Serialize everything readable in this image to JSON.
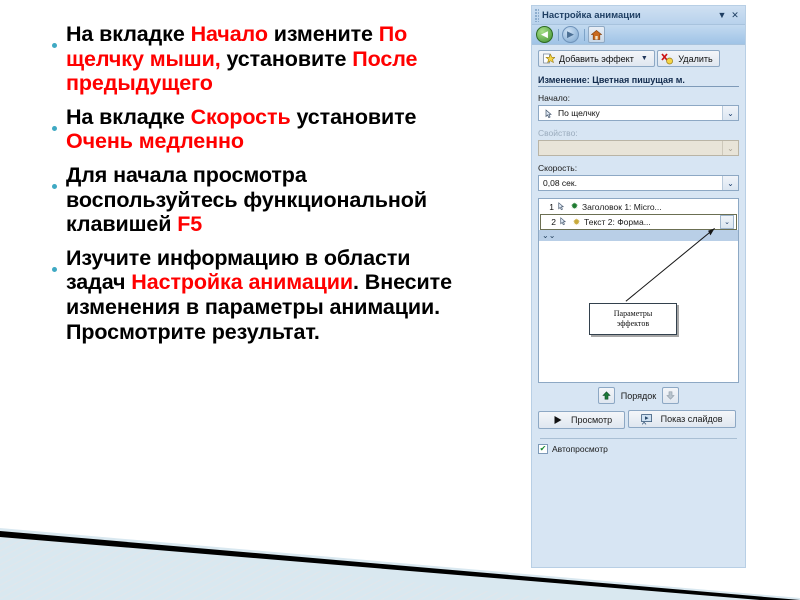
{
  "slide": {
    "bullets": [
      {
        "id": "bullet-1",
        "segments": [
          {
            "text": "На вкладке ",
            "highlight": false
          },
          {
            "text": "Начало",
            "highlight": true
          },
          {
            "text": " измените ",
            "highlight": false
          },
          {
            "text": "По щелчку мыши,",
            "highlight": true
          },
          {
            "text": " установите ",
            "highlight": false
          },
          {
            "text": "После предыдущего",
            "highlight": true
          }
        ]
      },
      {
        "id": "bullet-2",
        "segments": [
          {
            "text": "На вкладке ",
            "highlight": false
          },
          {
            "text": "Скорость",
            "highlight": true
          },
          {
            "text": " установите ",
            "highlight": false
          },
          {
            "text": "Очень медленно",
            "highlight": true
          }
        ]
      },
      {
        "id": "bullet-3",
        "segments": [
          {
            "text": "Для начала просмотра воспользуйтесь функциональной клавишей ",
            "highlight": false
          },
          {
            "text": "F5",
            "highlight": true
          }
        ]
      },
      {
        "id": "bullet-4",
        "segments": [
          {
            "text": "Изучите информацию в области задач ",
            "highlight": false
          },
          {
            "text": "Настройка анимации",
            "highlight": true
          },
          {
            "text": ". Внесите изменения в параметры анимации. Просмотрите результат.",
            "highlight": false
          }
        ]
      }
    ],
    "colors": {
      "bullet_dot": "#3fa9c3",
      "highlight": "#ff0000",
      "body_text": "#000000",
      "decoration_band": "#d9e8f0",
      "decoration_line": "#000000"
    }
  },
  "pane": {
    "title": "Настройка анимации",
    "titlebar": {
      "menu_icon": "chevron-down-icon",
      "menu_glyph": "▼",
      "close_icon": "close-icon",
      "close_glyph": "✕"
    },
    "navbar": {
      "back_icon": "back-arrow-icon",
      "back_glyph": "◀",
      "forward_icon": "forward-arrow-icon",
      "forward_glyph": "▶",
      "home_icon": "home-icon",
      "home_glyph": "⌂"
    },
    "add_effect_button": {
      "label": "Добавить эффект",
      "icon": "star-effect-icon",
      "icon_glyph": "✩",
      "caret_glyph": "▼"
    },
    "remove_button": {
      "label": "Удалить",
      "icon": "delete-x-icon",
      "icon_glyph": "✗"
    },
    "effect_title": "Изменение: Цветная пишущая м.",
    "start_field": {
      "label": "Начало:",
      "value": "По щелчку",
      "icon": "mouse-click-icon",
      "icon_glyph": "☞",
      "arrow_glyph": "⌄"
    },
    "property_field": {
      "label": "Свойство:",
      "value": "",
      "disabled": true,
      "arrow_glyph": "⌄"
    },
    "speed_field": {
      "label": "Скорость:",
      "value": "0,08 сек.",
      "arrow_glyph": "⌄"
    },
    "animation_list": {
      "items": [
        {
          "number": "1",
          "mouse_glyph": "☞",
          "star_glyph": "✹",
          "star_color": "#1d7a2e",
          "label": "Заголовок 1: Micro...",
          "selected": false
        },
        {
          "number": "2",
          "mouse_glyph": "☞",
          "star_glyph": "✹",
          "star_color": "#c8a93a",
          "label": "Текст 2: Форма...",
          "selected": true,
          "dropdown_glyph": "⌄"
        }
      ],
      "expander_glyph": "⌄⌄"
    },
    "callout": {
      "line1": "Параметры",
      "line2": "эффектов"
    },
    "order": {
      "label": "Порядок",
      "up_glyph": "⬆",
      "down_glyph": "⬇",
      "up_icon": "move-up-icon",
      "down_icon": "move-down-icon"
    },
    "preview_button": {
      "label": "Просмотр",
      "icon": "play-icon",
      "icon_glyph": "▶"
    },
    "slideshow_button": {
      "label": "Показ слайдов",
      "icon": "slideshow-icon",
      "icon_glyph": "▣"
    },
    "autopreview": {
      "label": "Автопросмотр",
      "checked": true,
      "check_glyph": "✔"
    },
    "colors": {
      "background": "#d7e5f3",
      "border": "#b8cfe5",
      "title_text": "#1f3f63",
      "selection": "#b9cfe7"
    }
  }
}
